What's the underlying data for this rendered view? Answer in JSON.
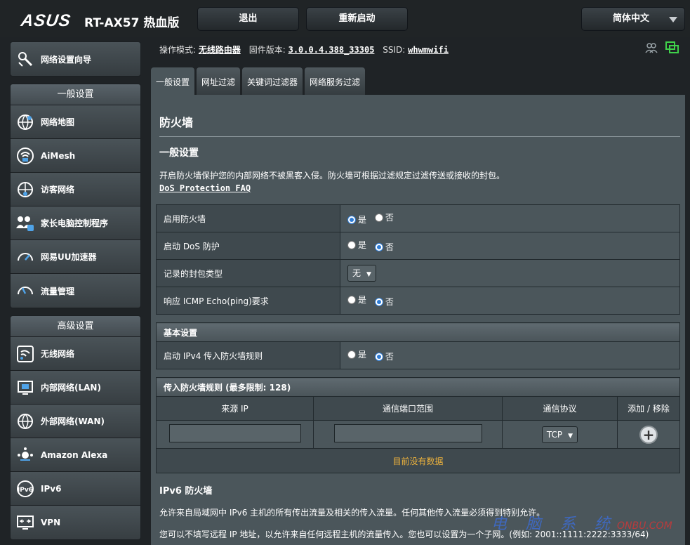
{
  "header": {
    "brand": "ASUS",
    "model": "RT-AX57 热血版",
    "logout": "退出",
    "reboot": "重新启动",
    "language": "简体中文"
  },
  "sidebar": {
    "wizard": "网络设置向导",
    "general_title": "一般设置",
    "general_items": [
      "网络地图",
      "AiMesh",
      "访客网络",
      "家长电脑控制程序",
      "网易UU加速器",
      "流量管理"
    ],
    "advanced_title": "高级设置",
    "advanced_items": [
      "无线网络",
      "内部网络(LAN)",
      "外部网络(WAN)",
      "Amazon Alexa",
      "IPv6",
      "VPN"
    ]
  },
  "info": {
    "mode_label": "操作模式:",
    "mode_value": "无线路由器",
    "firmware_label": "固件版本:",
    "firmware_value": "3.0.0.4.388_33305",
    "ssid_label": "SSID:",
    "ssid_value": "whwmwifi"
  },
  "tabs": [
    "一般设置",
    "网址过滤",
    "关键词过滤器",
    "网络服务过滤"
  ],
  "content": {
    "title": "防火墙",
    "subtitle": "一般设置",
    "description": "开启防火墙保护您的内部网络不被黑客入侵。防火墙可根据过滤规定过滤传送或接收的封包。",
    "faq_link": "DoS Protection FAQ",
    "rows": [
      {
        "label": "启用防火墙",
        "yes": "是",
        "no": "否",
        "selected": "yes"
      },
      {
        "label": "启动 DoS 防护",
        "yes": "是",
        "no": "否",
        "selected": "no"
      },
      {
        "label": "记录的封包类型",
        "select_value": "无"
      },
      {
        "label": "响应 ICMP Echo(ping)要求",
        "yes": "是",
        "no": "否",
        "selected": "no"
      }
    ],
    "basic_title": "基本设置",
    "ipv4_row": {
      "label": "启动 IPv4 传入防火墙规则",
      "yes": "是",
      "no": "否",
      "selected": "no"
    },
    "rules": {
      "title": "传入防火墙规则 (最多限制: 128)",
      "col_source": "来源 IP",
      "col_port": "通信端口范围",
      "col_protocol": "通信协议",
      "col_action": "添加 / 移除",
      "protocol_value": "TCP",
      "empty": "目前没有数据"
    },
    "ipv6_title": "IPv6 防火墙",
    "ipv6_desc1": "允许来自局域网中 IPv6 主机的所有传出流量及相关的传入流量。任何其他传入流量必须得到特别允许。",
    "ipv6_desc2": "您可以不填写远程 IP 地址，以允许来自任何远程主机的流量传入。您也可以设置为一个子网。(例如: 2001::1111:2222:3333/64)"
  },
  "watermark": "电 脑 系 统",
  "watermark_domain": "ONBU.COM",
  "colors": {
    "accent": "#2e7cd6",
    "empty_text": "#f0b43c",
    "background": "#1f2326",
    "panel": "#4b565b"
  }
}
